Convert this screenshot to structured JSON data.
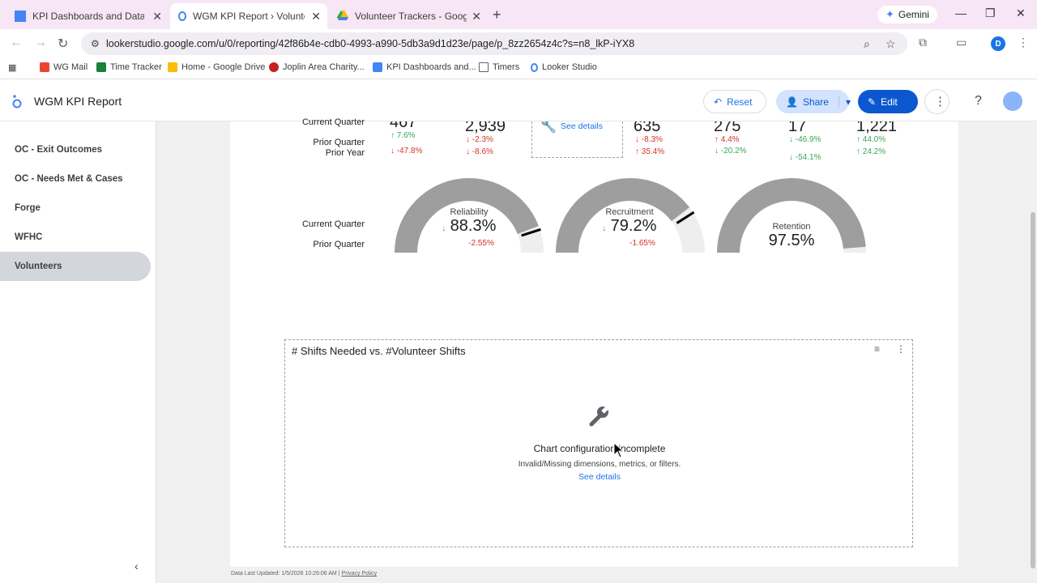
{
  "browser": {
    "tabs": [
      {
        "title": "KPI Dashboards and Data Links",
        "active": false
      },
      {
        "title": "WGM KPI Report › Volunteers",
        "active": true
      },
      {
        "title": "Volunteer Trackers - Google Dri",
        "active": false
      }
    ],
    "gemini_label": "Gemini",
    "url": "lookerstudio.google.com/u/0/reporting/42f86b4e-cdb0-4993-a990-5db3a9d1d23e/page/p_8zz2654z4c?s=n8_lkP-iYX8",
    "profile_initial": "D",
    "bookmarks": [
      {
        "label": "WG Mail",
        "color": "#ea4335"
      },
      {
        "label": "Time Tracker",
        "color": "#188038"
      },
      {
        "label": "Home - Google Drive",
        "color": "#fbbc04"
      },
      {
        "label": "Joplin Area Charity...",
        "color": "#c5221f"
      },
      {
        "label": "KPI Dashboards and...",
        "color": "#4285f4"
      },
      {
        "label": "Timers",
        "color": "#5f6368"
      },
      {
        "label": "Looker Studio",
        "color": "#4285f4"
      }
    ]
  },
  "header": {
    "report_title": "WGM KPI Report",
    "reset_label": "Reset",
    "share_label": "Share",
    "edit_label": "Edit"
  },
  "sidebar": {
    "items": [
      {
        "label": "OC - Exit Outcomes",
        "active": false
      },
      {
        "label": "OC - Needs Met & Cases",
        "active": false
      },
      {
        "label": "Forge",
        "active": false
      },
      {
        "label": "WFHC",
        "active": false
      },
      {
        "label": "Volunteers",
        "active": true
      }
    ]
  },
  "scorecards": {
    "row_labels": {
      "current": "Current Quarter",
      "prior_quarter": "Prior Quarter",
      "prior_year": "Prior Year"
    },
    "see_details": "See details",
    "cards": [
      {
        "value": "467",
        "d1": "7.6%",
        "d1_dir": "up",
        "d1_color": "green",
        "d2": "-47.8%",
        "d2_dir": "down",
        "d2_color": "red"
      },
      {
        "value": "2,939",
        "d1": "-2.3%",
        "d1_dir": "down",
        "d1_color": "red",
        "d2": "-8.6%",
        "d2_dir": "down",
        "d2_color": "red"
      },
      {
        "value": "635",
        "d1": "-8.3%",
        "d1_dir": "down",
        "d1_color": "red",
        "d2": "35.4%",
        "d2_dir": "up",
        "d2_color": "red"
      },
      {
        "value": "275",
        "d1": "4.4%",
        "d1_dir": "up",
        "d1_color": "red",
        "d2": "-20.2%",
        "d2_dir": "down",
        "d2_color": "green"
      },
      {
        "value": "17",
        "d1": "-46.9%",
        "d1_dir": "down",
        "d1_color": "green",
        "d2": "-54.1%",
        "d2_dir": "down",
        "d2_color": "green"
      },
      {
        "value": "1,221",
        "d1": "44.0%",
        "d1_dir": "up",
        "d1_color": "green",
        "d2": "24.2%",
        "d2_dir": "up",
        "d2_color": "green"
      }
    ]
  },
  "gauges": {
    "row_labels": {
      "current": "Current Quarter",
      "prior": "Prior Quarter"
    },
    "items": [
      {
        "title": "Reliability",
        "value": "88.3%",
        "fraction": 0.883,
        "delta": "-2.55%",
        "has_arrow": true
      },
      {
        "title": "Recruitment",
        "value": "79.2%",
        "fraction": 0.792,
        "delta": "-1.65%",
        "has_arrow": true
      },
      {
        "title": "Retention",
        "value": "97.5%",
        "fraction": 0.975,
        "delta": "",
        "has_arrow": false
      }
    ]
  },
  "chart": {
    "title": "# Shifts Needed vs. #Volunteer Shifts",
    "message_title": "Chart configuration incomplete",
    "message_sub": "Invalid/Missing dimensions, metrics, or filters.",
    "see_details": "See details"
  },
  "footer": {
    "updated": "Data Last Updated: 1/5/2026 10:26:06 AM",
    "sep": "|",
    "privacy": "Privacy Policy"
  }
}
